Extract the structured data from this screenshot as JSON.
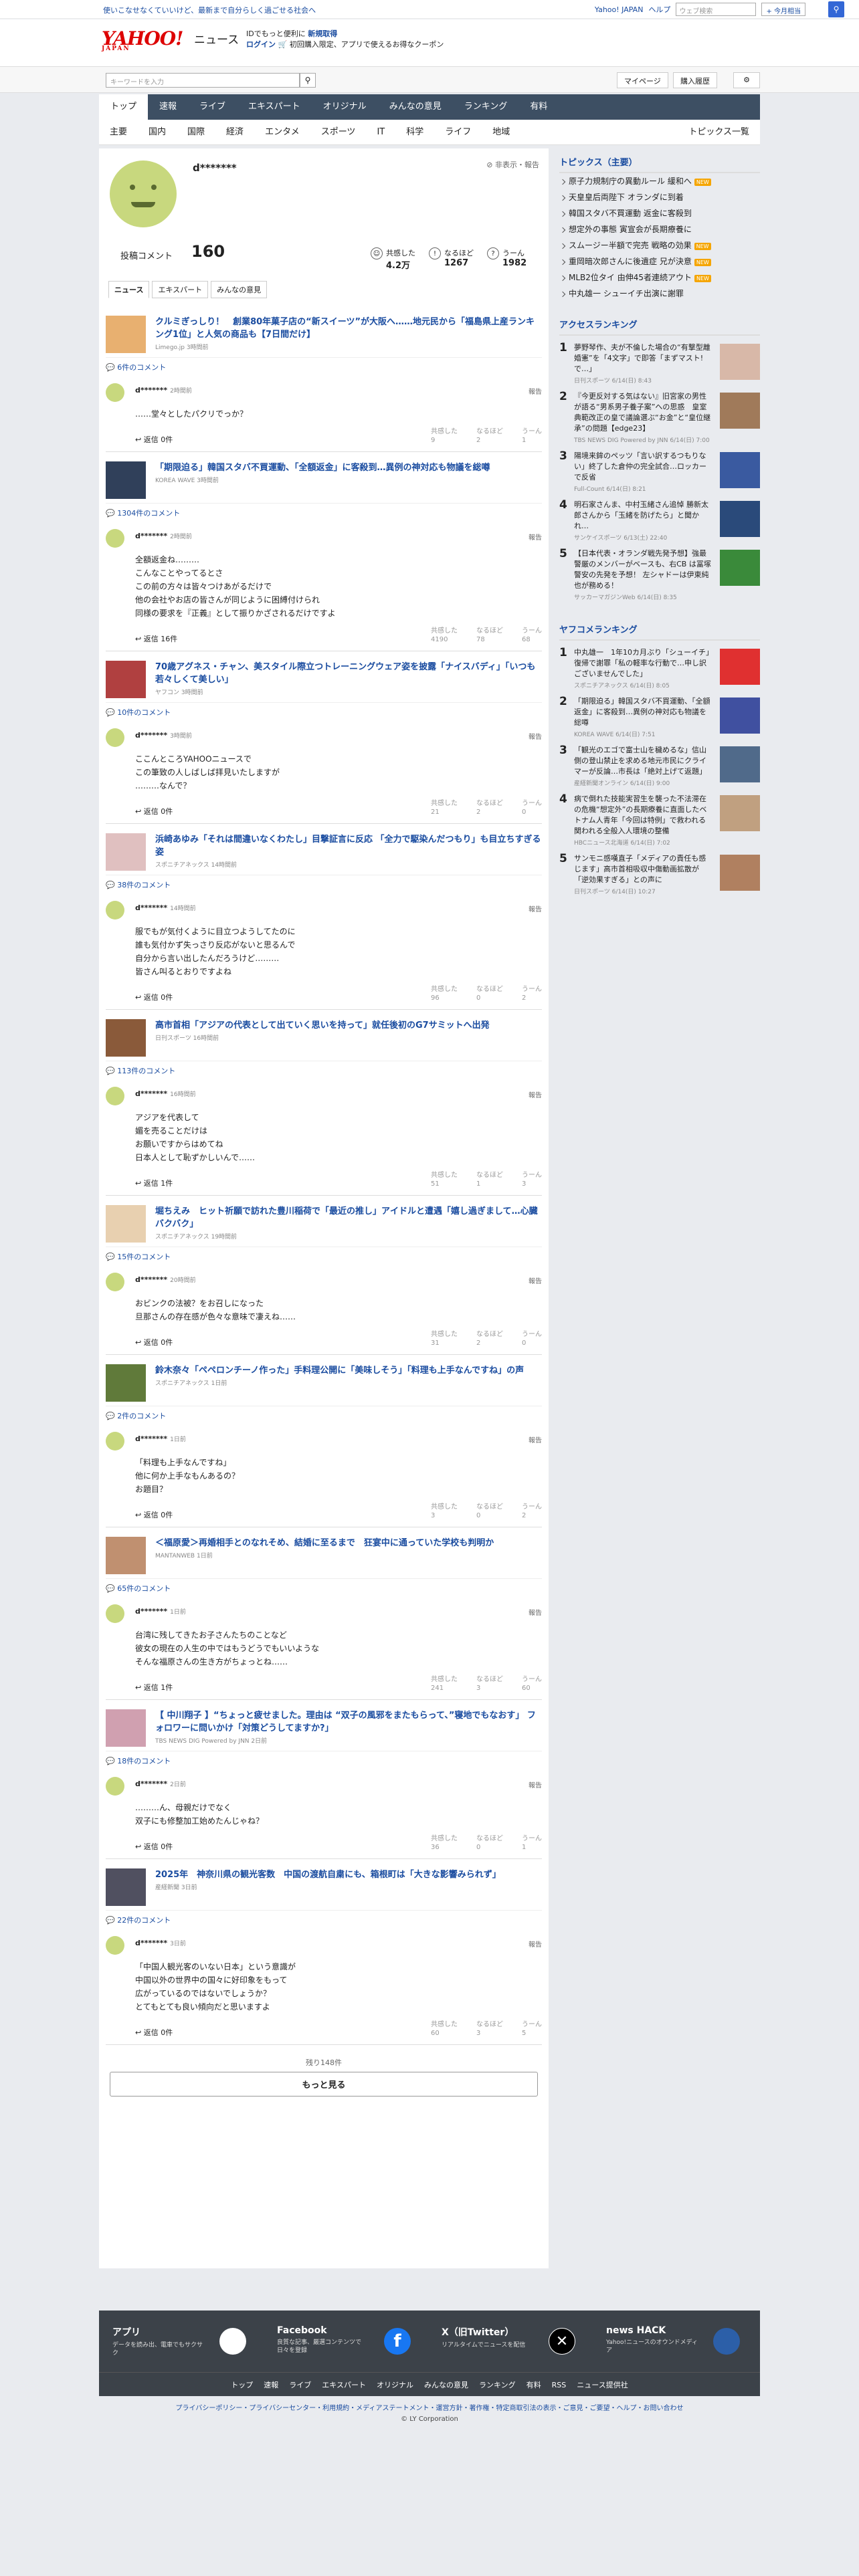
{
  "topbar": {
    "promo": "使いこなせなくていいけど、最新まで自分らしく過ごせる社会へ",
    "links": [
      "Yahoo! JAPAN",
      "ヘルプ"
    ],
    "search_placeholder": "ウェブ検索",
    "search_button": "+ 今月相当"
  },
  "header": {
    "logo": "YAHOO!",
    "logo_sub": "JAPAN",
    "service": "ニュース",
    "promo_line1": "IDでもっと便利に",
    "promo_strong": "新規取得",
    "promo_line2_login": "ログイン",
    "promo_line2": "初回購入限定、アプリで使えるお得なクーポン"
  },
  "bar2": {
    "keyword_placeholder": "キーワードを入力",
    "mypage": "マイページ",
    "history": "購入履歴"
  },
  "nav1": [
    "トップ",
    "速報",
    "ライブ",
    "エキスパート",
    "オリジナル",
    "みんなの意見",
    "ランキング",
    "有料"
  ],
  "nav2": [
    "主要",
    "国内",
    "国際",
    "経済",
    "エンタメ",
    "スポーツ",
    "IT",
    "科学",
    "ライフ",
    "地域"
  ],
  "nav2_right": "トピックス一覧",
  "profile": {
    "name": "d*******",
    "hidden": "非表示・報告",
    "comment_label": "投稿コメント",
    "comment_count": "160",
    "stats": [
      {
        "label": "共感した",
        "value": "4.2万"
      },
      {
        "label": "なるほど",
        "value": "1267"
      },
      {
        "label": "うーん",
        "value": "1982"
      }
    ]
  },
  "tabs": [
    "ニュース",
    "エキスパート",
    "みんなの意見"
  ],
  "items": [
    {
      "title": "クルミぎっしり！　創業80年菓子店の“新スイーツ”が大阪へ……地元民から「福島県上産ランキング1位」と人気の商品も【7日間だけ】",
      "source": "Limego.jp 3時間前",
      "count": "6件のコメント",
      "user": "d*******",
      "time": "2時間前",
      "body": "……堂々としたパクリでっか？",
      "reply": "返信 0件",
      "r": [
        "9",
        "2",
        "1"
      ]
    },
    {
      "title": "「期限迫る」韓国スタバ不買運動、「全額返金」に客殺到…異例の神対応も物議を総噂",
      "source": "KOREA WAVE 3時間前",
      "count": "1304件のコメント",
      "user": "d*******",
      "time": "2時間前",
      "body": "全額返金ね………\nこんなことやってるとさ\nこの前の方々は皆々つけあがるだけで\n他の会社やお店の皆さんが同じように困縛付けられ\n同様の要求を『正義』として振りかざされるだけですよ",
      "reply": "返信 16件",
      "r": [
        "4190",
        "78",
        "68"
      ]
    },
    {
      "title": "70歳アグネス・チャン、美スタイル際立つトレーニングウェア姿を披露「ナイスバディ」「いつも若々しくて美しい」",
      "source": "ヤフコン 3時間前",
      "count": "10件のコメント",
      "user": "d*******",
      "time": "3時間前",
      "body": "ここんところYAHOOニュースで\nこの筆致の人しばしば拝見いたしますが\n………なんで？",
      "reply": "返信 0件",
      "r": [
        "21",
        "2",
        "0"
      ]
    },
    {
      "title": "浜崎あゆみ「それは間違いなくわたし」目撃証言に反応 「全力で駆染んだつもり」も目立ちすぎる姿",
      "source": "スポニチアネックス 14時間前",
      "count": "38件のコメント",
      "user": "d*******",
      "time": "14時間前",
      "body": "服でもが気付くように目立つようしてたのに\n誰も気付かず失っさり反応がないと思るんで\n自分から言い出したんだろうけど………\n皆さん叫るとおりですよね",
      "reply": "返信 0件",
      "r": [
        "96",
        "0",
        "2"
      ]
    },
    {
      "title": "高市首相「アジアの代表として出ていく思いを持って」就任後初のG7サミットへ出発",
      "source": "日刊スポーツ 16時間前",
      "count": "113件のコメント",
      "user": "d*******",
      "time": "16時間前",
      "body": "アジアを代表して\n媚を売ることだけは\nお願いですからはめてね\n日本人として恥ずかしいんで……",
      "reply": "返信 1件",
      "r": [
        "51",
        "1",
        "3"
      ]
    },
    {
      "title": "堀ちえみ　ヒット祈願で訪れた豊川稲荷で「最近の推し」アイドルと遭遇「嬉し過ぎまして…心臓バクバク」",
      "source": "スポニチアネックス 19時間前",
      "count": "15件のコメント",
      "user": "d*******",
      "time": "20時間前",
      "body": "おビンクの法被？をお召しになった\n旦那さんの存在感が色々な意味で凄えね……",
      "reply": "返信 0件",
      "r": [
        "31",
        "2",
        "0"
      ]
    },
    {
      "title": "鈴木奈々「ペペロンチーノ作った」手料理公開に「美味しそう」「料理も上手なんですね」の声",
      "source": "スポニチアネックス 1日前",
      "count": "2件のコメント",
      "user": "d*******",
      "time": "1日前",
      "body": "「料理も上手なんですね」\n他に何か上手なもんあるの？\nお題目？",
      "reply": "返信 0件",
      "r": [
        "3",
        "0",
        "2"
      ]
    },
    {
      "title": "＜福原愛＞再婚相手とのなれそめ、結婚に至るまで　狂宴中に通っていた学校も判明か",
      "source": "MANTANWEB 1日前",
      "count": "65件のコメント",
      "user": "d*******",
      "time": "1日前",
      "body": "台湾に残してきたお子さんたちのことなど\n彼女の現在の人生の中ではもうどうでもいいような\nそんな福原さんの生き方がちょっとね……",
      "reply": "返信 1件",
      "r": [
        "241",
        "3",
        "60"
      ]
    },
    {
      "title": "【 中川翔子 】“ちょっと疲せました。理由は “双子の風邪をまたもらって、”寝地でもなおす」 フォロワーに問いかけ「対策どうしてますか?」",
      "source": "TBS NEWS DIG Powered by JNN 2日前",
      "count": "18件のコメント",
      "user": "d*******",
      "time": "2日前",
      "body": "………ん、母親だけでなく\n双子にも修整加工始めたんじゃね？",
      "reply": "返信 0件",
      "r": [
        "36",
        "0",
        "1"
      ]
    },
    {
      "title": "2025年　神奈川県の観光客数　中国の渡航自粛にも、箱根町は「大きな影響みられず」",
      "source": "産経新聞 3日前",
      "count": "22件のコメント",
      "user": "d*******",
      "time": "3日前",
      "body": "「中国人観光客のいない日本」という意識が\n中国以外の世界中の国々に好印象をもって\n広がっているのではないでしょうか？\nとてもとても良い傾向だと思いますよ",
      "reply": "返信 0件",
      "r": [
        "60",
        "3",
        "5"
      ]
    }
  ],
  "react_labels": [
    "共感した",
    "なるほど",
    "うーん"
  ],
  "report": "報告",
  "more": {
    "remaining": "残り148件",
    "button": "もっと見る"
  },
  "topics": {
    "heading": "トピックス（主要）",
    "items": [
      {
        "t": "原子力規制庁の異動ルール 緩和へ",
        "new": true
      },
      {
        "t": "天皇皇后両陛下 オランダに到着",
        "new": false
      },
      {
        "t": "韓国スタバ不買運動 返金に客殺到",
        "new": false
      },
      {
        "t": "想定外の事態 寅宣会が長期療養に",
        "new": false
      },
      {
        "t": "スムージー半額で完売 戦略の効果",
        "new": true
      },
      {
        "t": "重岡暗次郎さんに後遺症 兄が決意",
        "new": true
      },
      {
        "t": "MLB2位タイ 由伸45者連続アウト",
        "new": true
      },
      {
        "t": "中丸雄一 シューイチ出演に謝罪",
        "new": false
      }
    ]
  },
  "access_rank": {
    "heading": "アクセスランキング",
    "items": [
      {
        "t": "夢野琴作、夫が不倫した場合の“有撃型離婚憲”を「4文字」で即答「まずマスト!で…」",
        "s": "日刊スポーツ 6/14(日) 8:43"
      },
      {
        "t": "『今更反対する気はない』旧宮家の男性が語る“男系男子養子案”への思惑　皇室典範改正の皇で議論選ぶ“お金”と“皇位継承”の問題【edge23】",
        "s": "TBS NEWS DIG Powered by JNN 6/14(日) 7:00"
      },
      {
        "t": "陽境来鉾のペッツ「言い訳するつもりない」終了した倉仲の完全試合…ロッカーで反省",
        "s": "Full-Count 6/14(日) 8:21"
      },
      {
        "t": "明石家さんま、中村玉緒さん追悼 勝新太郎さんから「玉緒を防げたら」と聞かれ…",
        "s": "サンケイスポーツ 6/13(土) 22:40"
      },
      {
        "t": "【日本代表・オランダ戦先発予想】強最警厳のメンバーがベースも、右CB は冨塚警安の先発を予想！ 左シャドーは伊東純也が務める！",
        "s": "サッカーマガジンWeb 6/14(日) 8:35"
      }
    ]
  },
  "yafcom_rank": {
    "heading": "ヤフコメランキング",
    "items": [
      {
        "t": "中丸雄一　1年10カ月ぶり「シューイチ」復帰で謝罪「私の軽率な行動で…申し訳ございませんでした」",
        "s": "スポニチアネックス 6/14(日) 8:05"
      },
      {
        "t": "「期限迫る」韓国スタバ不買運動、「全額返金」に客殺到…異例の神対応も物議を総噂",
        "s": "KOREA WAVE 6/14(日) 7:51"
      },
      {
        "t": "「観光のエゴで富士山を穢めるな」信山側の登山禁止を求める地元市民にクライマーが反論…市長は「絶対上げて返題」",
        "s": "産経新聞オンライン 6/14(日) 9:00"
      },
      {
        "t": "病で倒れた技能実習生を襲った不法滞在の危機“想定外”の長期療養に直面したベトナム人青年「今回は特例」で救われる　関われる全般入人環境の整備",
        "s": "HBCニュース北海道 6/14(日) 7:02"
      },
      {
        "t": "サンモニ感嘆直子「メディアの責任も感じます」高市首相吸収中傷動画拡散が「逆効果すぎる」との声に",
        "s": "日刊スポーツ 6/14(日) 10:27"
      }
    ]
  },
  "footer": {
    "cols": [
      {
        "title": "アプリ",
        "desc": "データを読み出、電車でもサクサク"
      },
      {
        "title": "Facebook",
        "desc": "良質な記事、厳選コンテンツで日々を登録"
      },
      {
        "title": "X（旧Twitter）",
        "desc": "リアルタイムでニュースを配信"
      },
      {
        "title": "news HACK",
        "desc": "Yahoo!ニュースのオウンドメディア"
      }
    ],
    "links": [
      "トップ",
      "速報",
      "ライブ",
      "エキスパート",
      "オリジナル",
      "みんなの意見",
      "ランキング",
      "有料",
      "RSS",
      "ニュース提供社"
    ],
    "legal": "プライバシーポリシー・プライバシーセンター・利用規約・メディアステートメント・運営方針・著作権・特定商取引法の表示・ご意見・ご要望・ヘルプ・お問い合わせ",
    "copyright": "© LY Corporation"
  },
  "colors": {
    "nav": "#3d4f63",
    "link": "#1a4ca0",
    "avatar": "#c8d87e",
    "brand": "#d00",
    "new": "#f5a500"
  }
}
